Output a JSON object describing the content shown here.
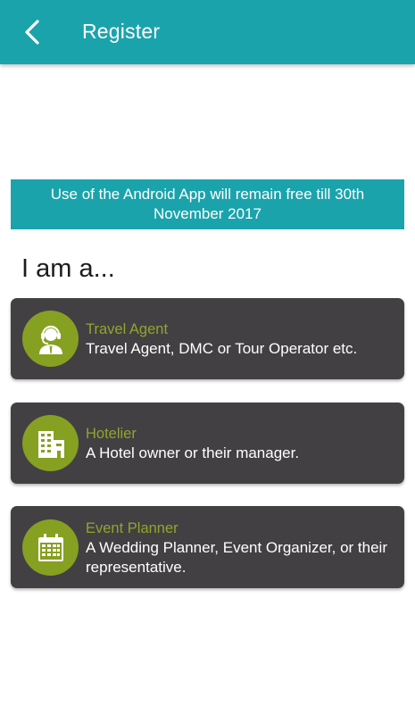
{
  "app_bar": {
    "title": "Register",
    "back_icon": "chevron-left-icon",
    "color": "#1ba3ac"
  },
  "banner": {
    "text": "Use of the Android App will remain free till 30th November 2017"
  },
  "heading": "I am a...",
  "roles": [
    {
      "title": "Travel Agent",
      "description": "Travel Agent, DMC or Tour Operator etc.",
      "icon": "headset-person-icon"
    },
    {
      "title": "Hotelier",
      "description": "A Hotel owner or their manager.",
      "icon": "building-icon"
    },
    {
      "title": "Event Planner",
      "description": "A Wedding Planner, Event Organizer, or their representative.",
      "icon": "calendar-icon"
    }
  ],
  "colors": {
    "accent": "#1ba3ac",
    "card_bg": "#434043",
    "icon_bg": "#86a022",
    "role_title": "#8fa62c"
  }
}
